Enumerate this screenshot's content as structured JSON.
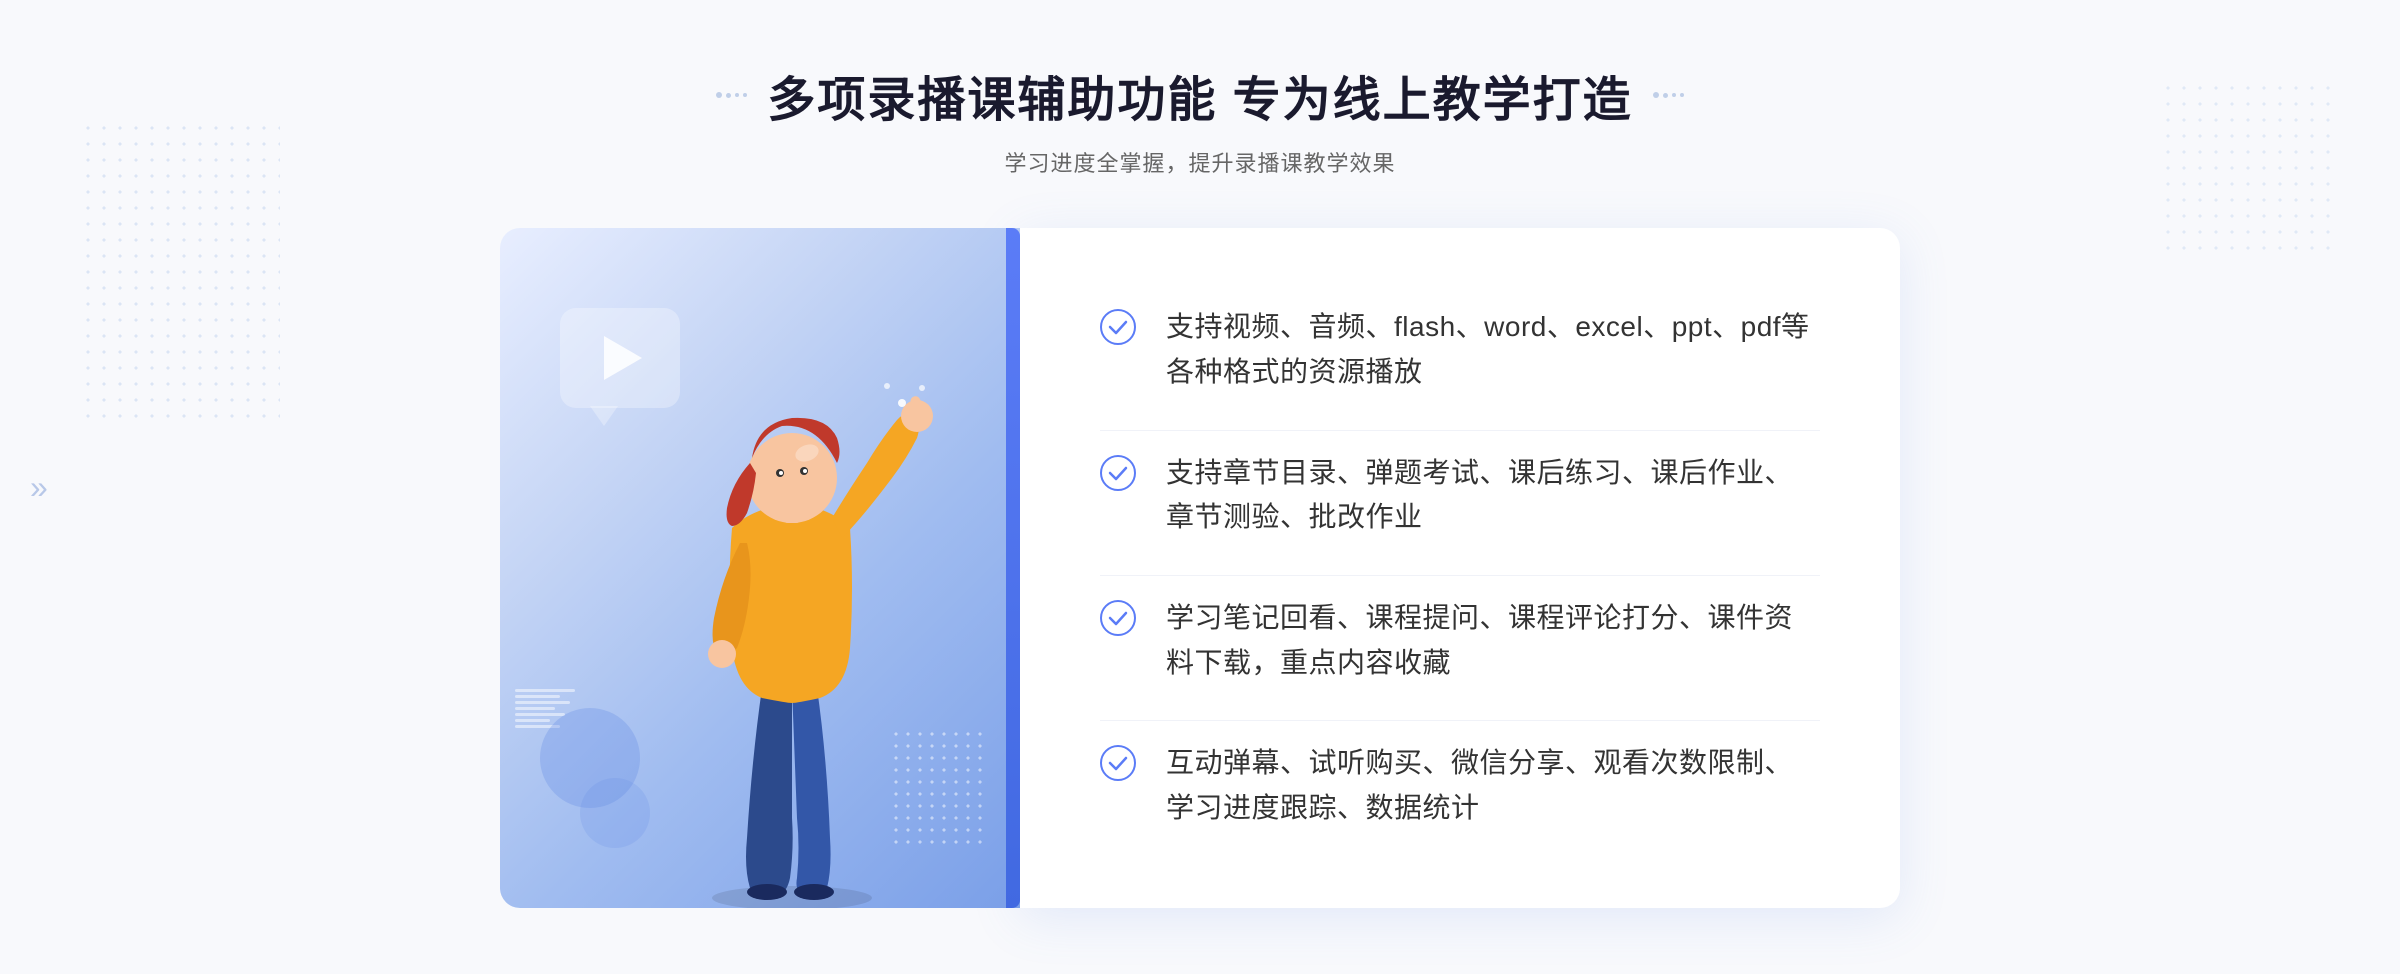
{
  "header": {
    "title": "多项录播课辅助功能 专为线上教学打造",
    "subtitle": "学习进度全掌握，提升录播课教学效果"
  },
  "features": [
    {
      "id": "feature-1",
      "text": "支持视频、音频、flash、word、excel、ppt、pdf等各种格式的资源播放"
    },
    {
      "id": "feature-2",
      "text": "支持章节目录、弹题考试、课后练习、课后作业、章节测验、批改作业"
    },
    {
      "id": "feature-3",
      "text": "学习笔记回看、课程提问、课程评论打分、课件资料下载，重点内容收藏"
    },
    {
      "id": "feature-4",
      "text": "互动弹幕、试听购买、微信分享、观看次数限制、学习进度跟踪、数据统计"
    }
  ],
  "colors": {
    "accent_blue": "#4169e1",
    "light_blue": "#6b8ff0",
    "check_color": "#5b7cf7",
    "text_dark": "#1a1a2e",
    "text_gray": "#666666"
  },
  "decorators": {
    "left": "»",
    "right": "»"
  }
}
